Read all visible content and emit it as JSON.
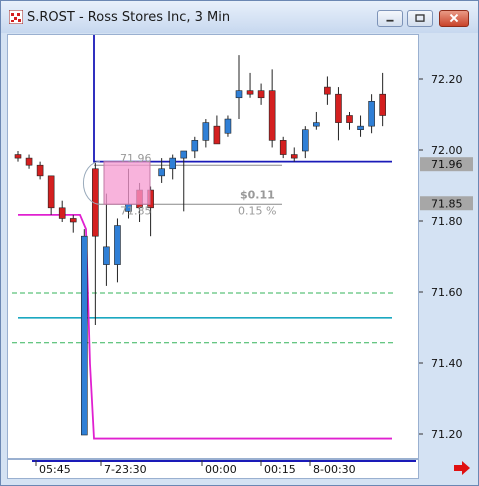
{
  "window": {
    "title": "S.ROST - Ross Stores Inc, 3 Min"
  },
  "icons": {
    "app": "chart-app-icon",
    "minimize": "minimize-icon",
    "maximize": "maximize-icon",
    "close": "close-icon",
    "scroll_right": "arrow-right-icon"
  },
  "colors": {
    "up_candle": "#2f7fd6",
    "down_candle": "#d41f1f",
    "price_line": "#1a1ab8",
    "magenta_line": "#e020d0",
    "green_dash": "#33b35a",
    "teal_line": "#1ba8c0",
    "pink_box": "#f59ad0"
  },
  "annotations": {
    "level_high": "71.96",
    "level_low": "71.85",
    "change_amount": "$0.11",
    "change_pct": "0.15 %"
  },
  "chart_data": {
    "type": "candlestick",
    "y_axis": {
      "ticks": [
        "72.20",
        "72.00",
        "71.80",
        "71.60",
        "71.40",
        "71.20"
      ],
      "ylim": [
        71.16,
        72.32
      ]
    },
    "price_tags": [
      "71.96",
      "71.85"
    ],
    "x_axis": {
      "labels": [
        "05:45",
        "7-23:30",
        "00:00",
        "00:15",
        "8-00:30"
      ]
    },
    "reference_lines": [
      {
        "name": "prev-high",
        "value": 71.97,
        "color": "#1a1ab8"
      },
      {
        "name": "prev-low",
        "value": 71.19,
        "color": "#e020d0"
      },
      {
        "name": "green-upper",
        "value": 71.6,
        "color": "#33b35a",
        "dashed": true
      },
      {
        "name": "teal",
        "value": 71.53,
        "color": "#1ba8c0"
      },
      {
        "name": "green-lower",
        "value": 71.46,
        "color": "#33b35a",
        "dashed": true
      }
    ],
    "candles": [
      {
        "o": 71.99,
        "h": 72.0,
        "l": 71.97,
        "c": 71.98
      },
      {
        "o": 71.98,
        "h": 71.99,
        "l": 71.95,
        "c": 71.96
      },
      {
        "o": 71.96,
        "h": 71.97,
        "l": 71.92,
        "c": 71.93
      },
      {
        "o": 71.93,
        "h": 71.93,
        "l": 71.82,
        "c": 71.84
      },
      {
        "o": 71.84,
        "h": 71.86,
        "l": 71.8,
        "c": 71.81
      },
      {
        "o": 71.81,
        "h": 71.82,
        "l": 71.77,
        "c": 71.8
      },
      {
        "o": 71.76,
        "h": 71.78,
        "l": 71.2,
        "c": 71.2,
        "up": true
      },
      {
        "o": 71.95,
        "h": 71.97,
        "l": 71.51,
        "c": 71.76
      },
      {
        "o": 71.73,
        "h": 71.88,
        "l": 71.62,
        "c": 71.68,
        "up": true
      },
      {
        "o": 71.68,
        "h": 71.81,
        "l": 71.63,
        "c": 71.79,
        "up": true
      },
      {
        "o": 71.83,
        "h": 71.95,
        "l": 71.81,
        "c": 71.85,
        "up": true
      },
      {
        "o": 71.89,
        "h": 71.91,
        "l": 71.8,
        "c": 71.84
      },
      {
        "o": 71.84,
        "h": 71.9,
        "l": 71.76,
        "c": 71.89
      },
      {
        "o": 71.93,
        "h": 71.98,
        "l": 71.91,
        "c": 71.95,
        "up": true
      },
      {
        "o": 71.95,
        "h": 71.99,
        "l": 71.92,
        "c": 71.98,
        "up": true
      },
      {
        "o": 71.98,
        "h": 72.0,
        "l": 71.83,
        "c": 72.0,
        "up": true
      },
      {
        "o": 72.0,
        "h": 72.04,
        "l": 71.98,
        "c": 72.03,
        "up": true
      },
      {
        "o": 72.03,
        "h": 72.09,
        "l": 72.01,
        "c": 72.08,
        "up": true
      },
      {
        "o": 72.07,
        "h": 72.1,
        "l": 72.02,
        "c": 72.02
      },
      {
        "o": 72.05,
        "h": 72.1,
        "l": 72.04,
        "c": 72.09,
        "up": true
      },
      {
        "o": 72.15,
        "h": 72.27,
        "l": 72.09,
        "c": 72.17,
        "up": true
      },
      {
        "o": 72.17,
        "h": 72.22,
        "l": 72.15,
        "c": 72.16
      },
      {
        "o": 72.17,
        "h": 72.19,
        "l": 72.13,
        "c": 72.15
      },
      {
        "o": 72.17,
        "h": 72.23,
        "l": 72.01,
        "c": 72.03
      },
      {
        "o": 72.03,
        "h": 72.04,
        "l": 71.98,
        "c": 71.99
      },
      {
        "o": 71.99,
        "h": 72.01,
        "l": 71.97,
        "c": 71.98
      },
      {
        "o": 72.0,
        "h": 72.07,
        "l": 71.98,
        "c": 72.06,
        "up": true
      },
      {
        "o": 72.07,
        "h": 72.11,
        "l": 72.06,
        "c": 72.08,
        "up": true
      },
      {
        "o": 72.18,
        "h": 72.21,
        "l": 72.13,
        "c": 72.16
      },
      {
        "o": 72.16,
        "h": 72.18,
        "l": 72.03,
        "c": 72.08
      },
      {
        "o": 72.08,
        "h": 72.11,
        "l": 72.06,
        "c": 72.1
      },
      {
        "o": 72.06,
        "h": 72.1,
        "l": 72.04,
        "c": 72.07,
        "up": true
      },
      {
        "o": 72.07,
        "h": 72.16,
        "l": 72.05,
        "c": 72.14,
        "up": true
      },
      {
        "o": 72.16,
        "h": 72.22,
        "l": 72.07,
        "c": 72.1
      }
    ]
  }
}
